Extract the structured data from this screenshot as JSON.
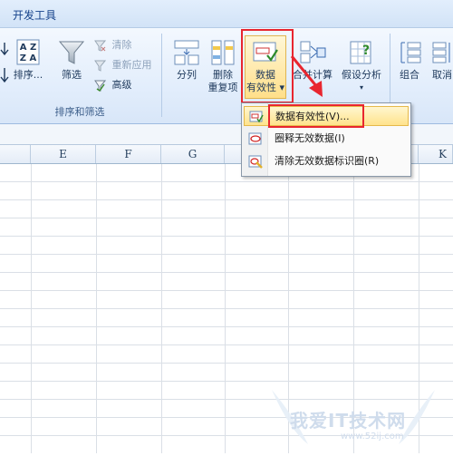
{
  "ribbon": {
    "tab_dev": "开发工具",
    "sort": {
      "az_label": "A Z",
      "sort_label": "排序...",
      "filter_label": "筛选",
      "clear_label": "清除",
      "reapply_label": "重新应用",
      "advanced_label": "高级",
      "group_label": "排序和筛选"
    },
    "datatools": {
      "split_label": "分列",
      "remove_label_1": "删除",
      "remove_label_2": "重复项",
      "validation_label_1": "数据",
      "validation_label_2": "有效性 ▾",
      "consolidate_label": "合并计算",
      "whatif_label": "假设分析",
      "whatif_arrow": "▾"
    },
    "outline": {
      "group_label": "组合",
      "ungroup_label": "取消"
    }
  },
  "sheet": {
    "columns": [
      "E",
      "F",
      "G",
      "",
      "",
      "",
      "K"
    ]
  },
  "menu": {
    "items": [
      {
        "label": "数据有效性(V)..."
      },
      {
        "label": "圈释无效数据(I)"
      },
      {
        "label": "清除无效数据标识圈(R)"
      }
    ]
  },
  "watermark": {
    "text": "我爱IT技术网",
    "url": "www.52ij.com"
  },
  "colors": {
    "highlight": "#e8262f",
    "ribbon": "#dde9f8",
    "menu_active": "#ffe38c"
  }
}
